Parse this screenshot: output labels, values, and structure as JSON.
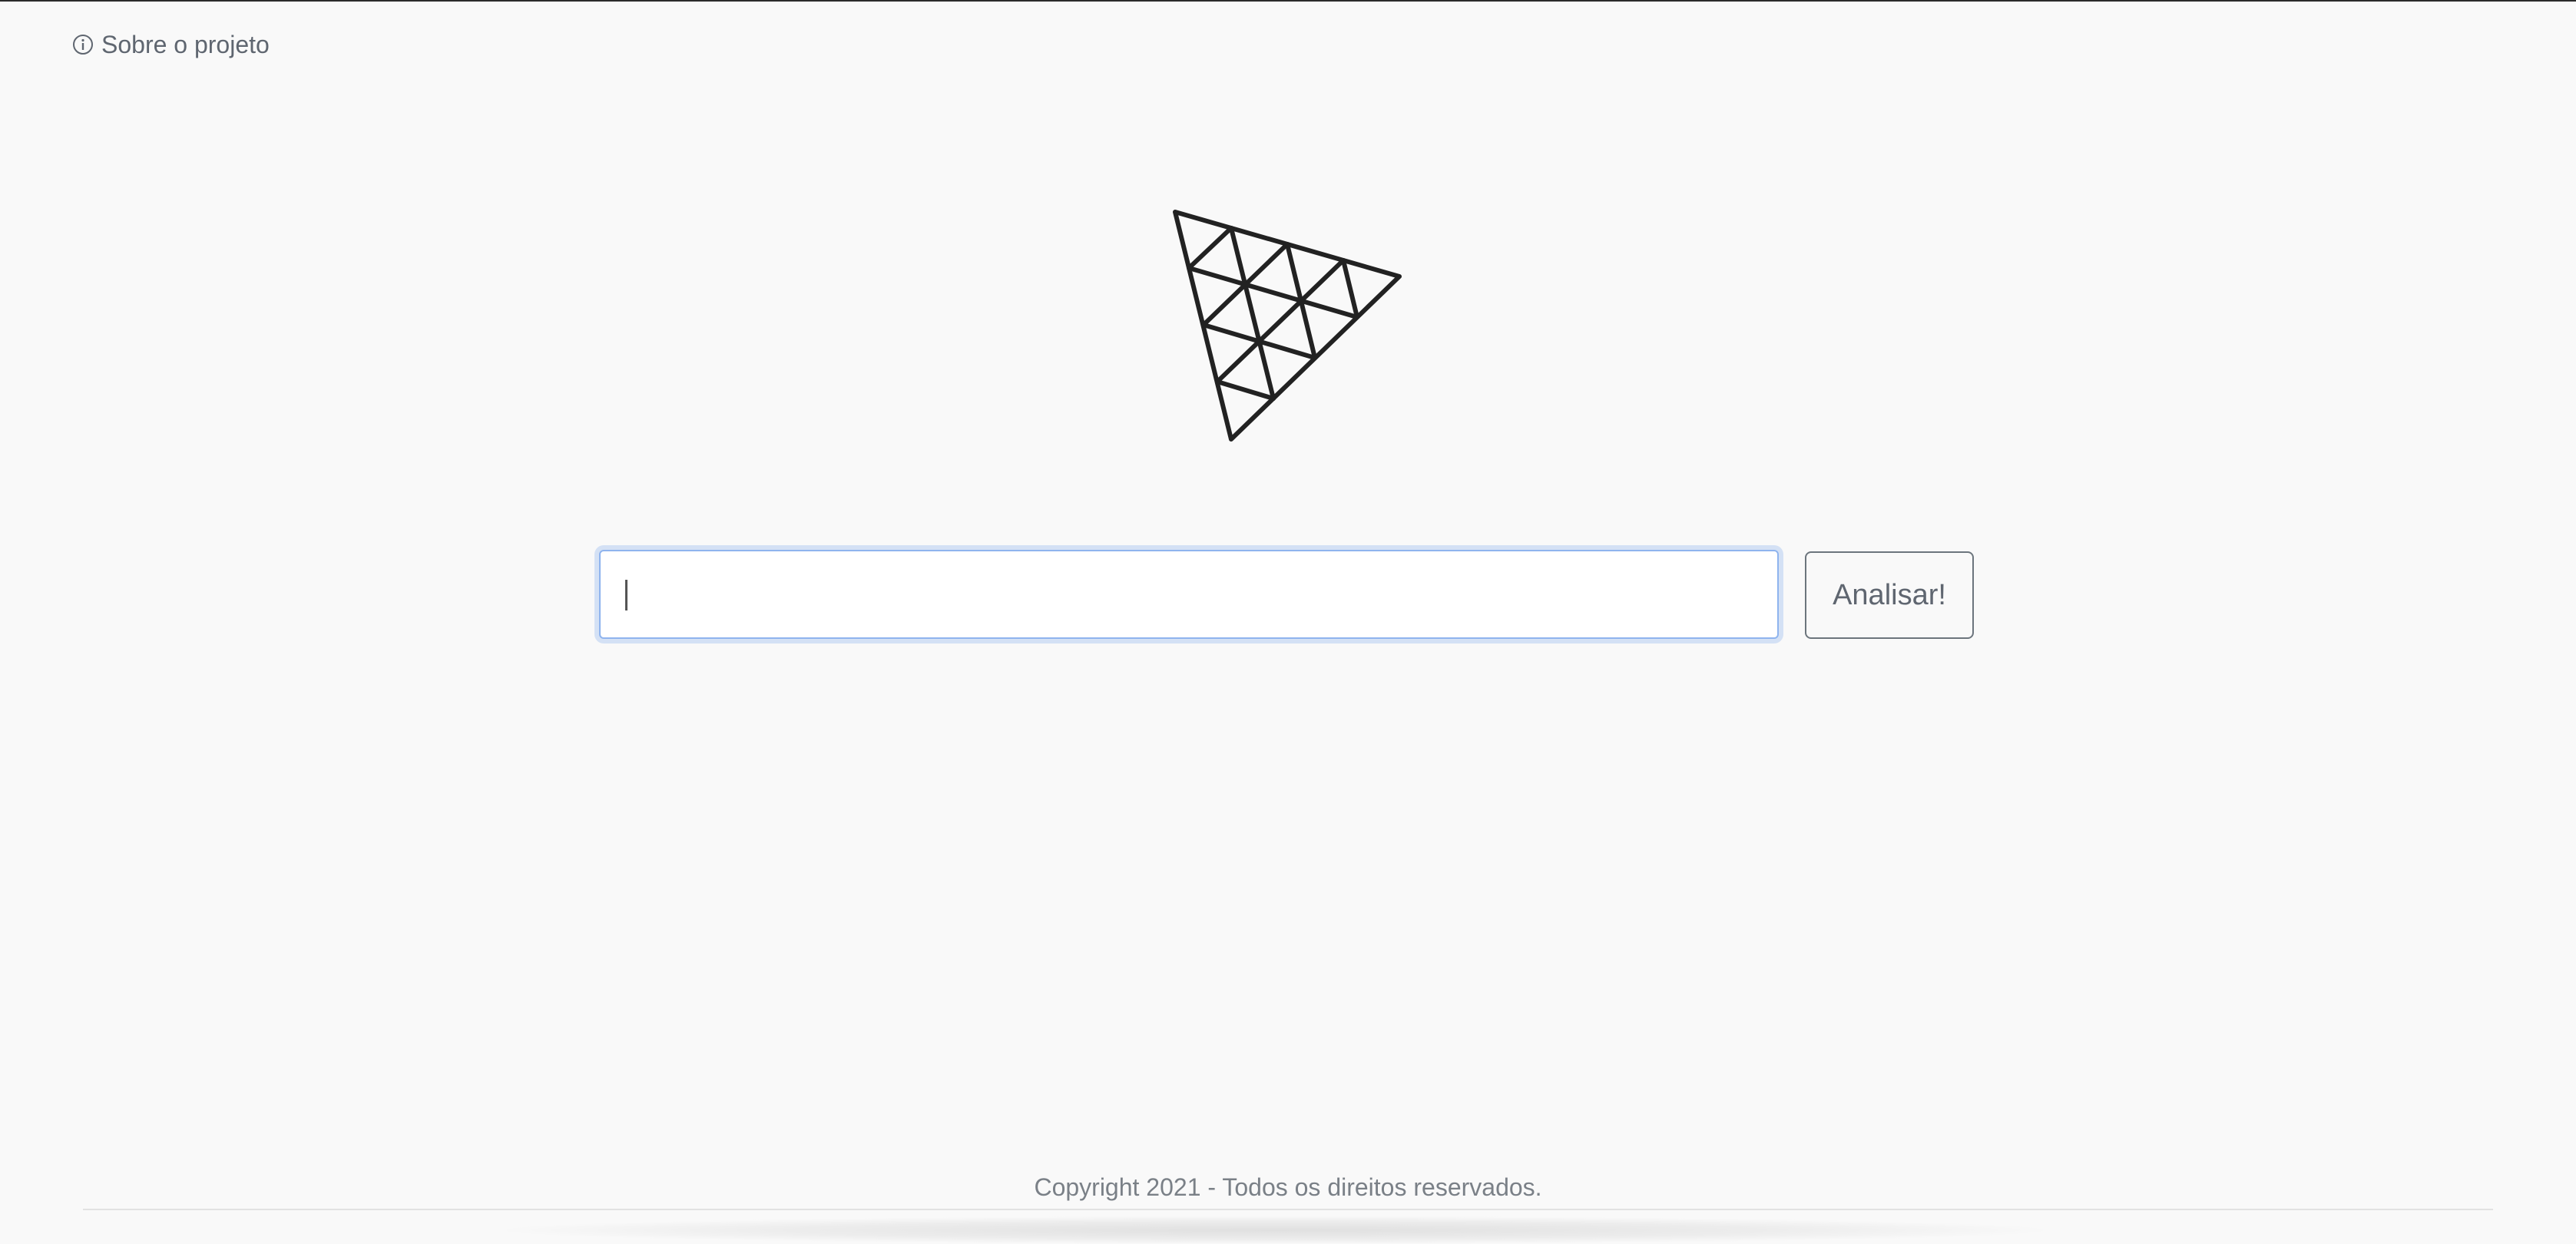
{
  "header": {
    "about_label": "Sobre o projeto",
    "about_icon": "info-circle-icon"
  },
  "logo": {
    "icon": "triangle-grid-logo-icon"
  },
  "search": {
    "value": "",
    "placeholder": ""
  },
  "actions": {
    "analyze_label": "Analisar!"
  },
  "footer": {
    "copyright": "Copyright 2021 - Todos os direitos reservados."
  },
  "colors": {
    "background": "#f9f9f9",
    "focus_ring": "#8fb4ee",
    "muted_text": "#5f6670",
    "logo_stroke": "#222222"
  }
}
